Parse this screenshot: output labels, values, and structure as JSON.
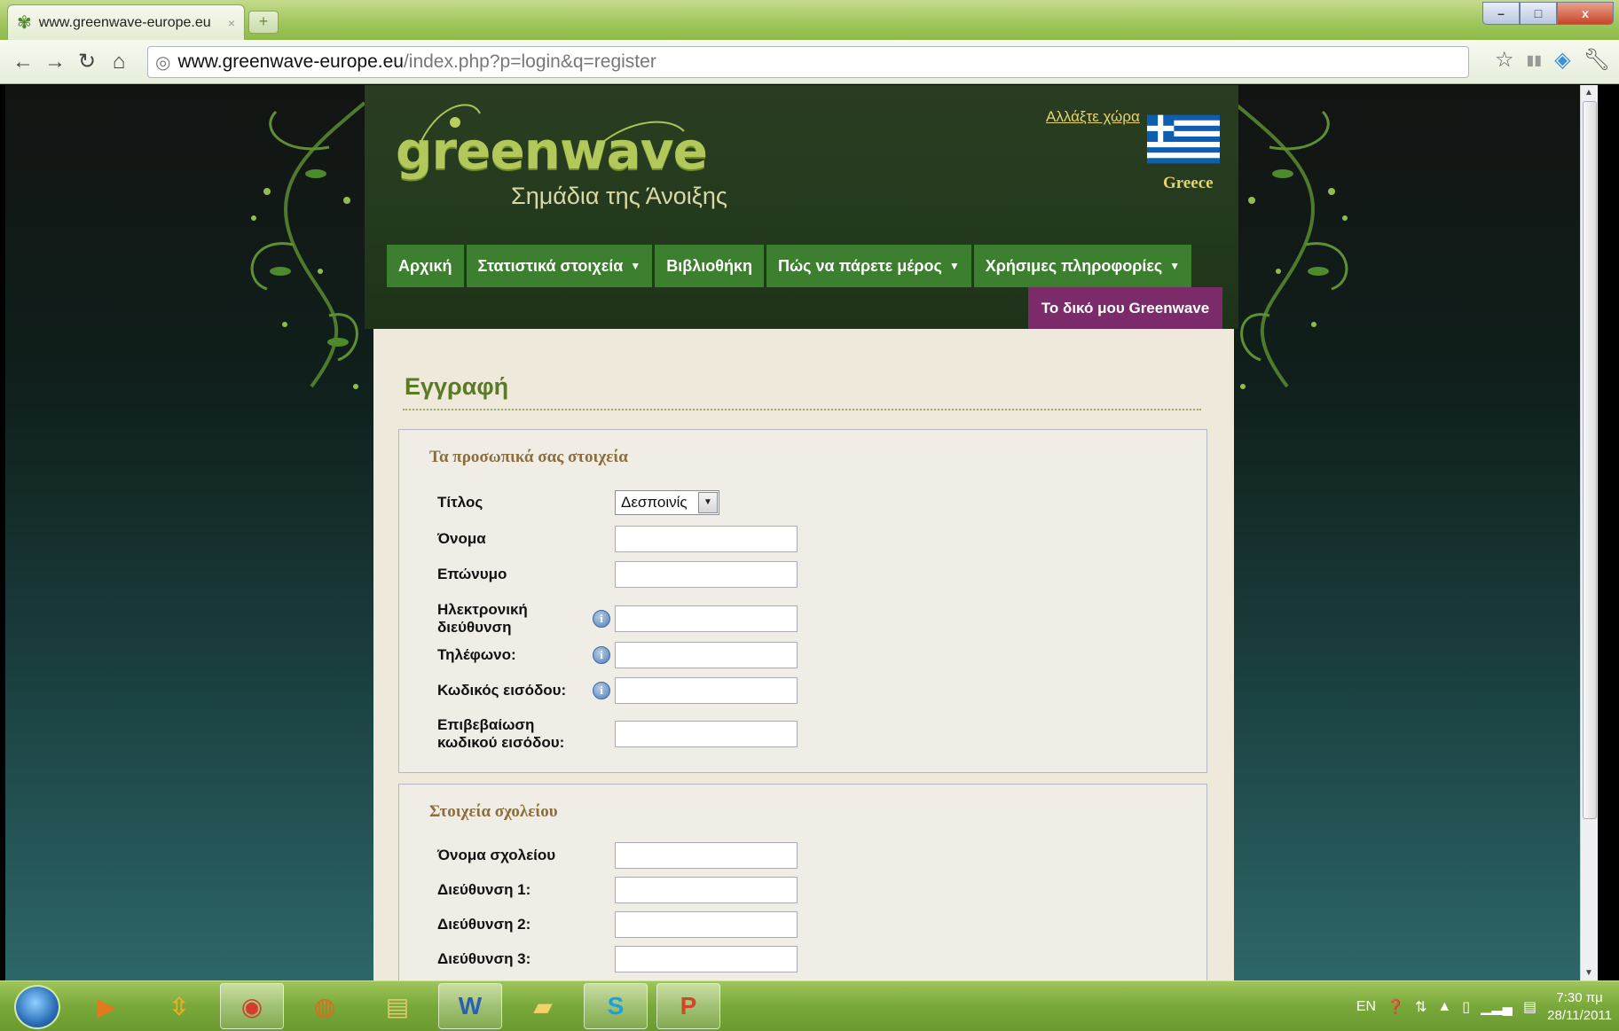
{
  "browser": {
    "tab_title": "www.greenwave-europe.eu",
    "tab_close": "×",
    "new_tab": "+",
    "url_domain": "www.greenwave-europe.eu",
    "url_path": "/index.php?p=login&q=register"
  },
  "site": {
    "logo": "greenwave",
    "tagline": "Σημάδια της Άνοιξης",
    "change_country": "Αλλάξτε χώρα",
    "country": "Greece",
    "nav": [
      {
        "label": "Αρχική",
        "has_menu": false
      },
      {
        "label": "Στατιστικά στοιχεία",
        "has_menu": true
      },
      {
        "label": "Βιβλιοθήκη",
        "has_menu": false
      },
      {
        "label": "Πώς να πάρετε μέρος",
        "has_menu": true
      },
      {
        "label": "Χρήσιμες πληροφορίες",
        "has_menu": true
      }
    ],
    "my_greenwave": "Το δικό μου Greenwave"
  },
  "form": {
    "page_title": "Εγγραφή",
    "personal": {
      "legend": "Τα προσωπικά σας στοιχεία",
      "title_label": "Τίτλος",
      "title_value": "Δεσποινίς",
      "name_label": "Όνομα",
      "surname_label": "Επώνυμο",
      "email_label": "Ηλεκτρονική διεύθυνση",
      "phone_label": "Τηλέφωνο:",
      "password_label": "Κωδικός εισόδου:",
      "confirm_label": "Επιβεβαίωση κωδικού εισόδου:"
    },
    "school": {
      "legend": "Στοιχεία σχολείου",
      "school_name_label": "Όνομα σχολείου",
      "address1_label": "Διεύθυνση 1:",
      "address2_label": "Διεύθυνση 2:",
      "address3_label": "Διεύθυνση 3:"
    }
  },
  "taskbar": {
    "lang": "EN",
    "time": "7:30 πμ",
    "date": "28/11/2011"
  },
  "colors": {
    "nav_green": "#3c7f2e",
    "my_greenwave_purple": "#7b2a6a",
    "title_green": "#5a7a26",
    "legend_brown": "#8c6d3c"
  }
}
